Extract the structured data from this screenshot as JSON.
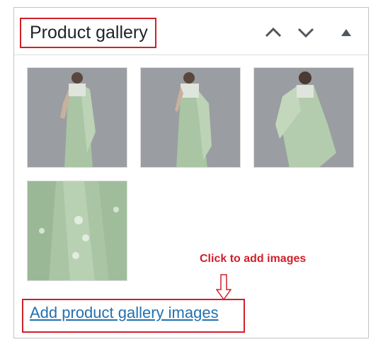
{
  "panel": {
    "title": "Product gallery",
    "controls": [
      {
        "name": "move-up-icon"
      },
      {
        "name": "move-down-icon"
      },
      {
        "name": "toggle-panel-icon"
      }
    ]
  },
  "gallery": {
    "images": [
      {
        "name": "saree-front-view"
      },
      {
        "name": "saree-side-view"
      },
      {
        "name": "saree-back-view"
      },
      {
        "name": "saree-fabric-closeup"
      }
    ]
  },
  "annotation": {
    "text": "Click to add images",
    "color": "#d0202a"
  },
  "add_images": {
    "label": "Add product gallery images",
    "color": "#2271b1"
  },
  "colors": {
    "border": "#c3c4c7",
    "highlight": "#d0202a",
    "photo_background": "#9a9da1",
    "fabric": "#a9c5a4"
  }
}
